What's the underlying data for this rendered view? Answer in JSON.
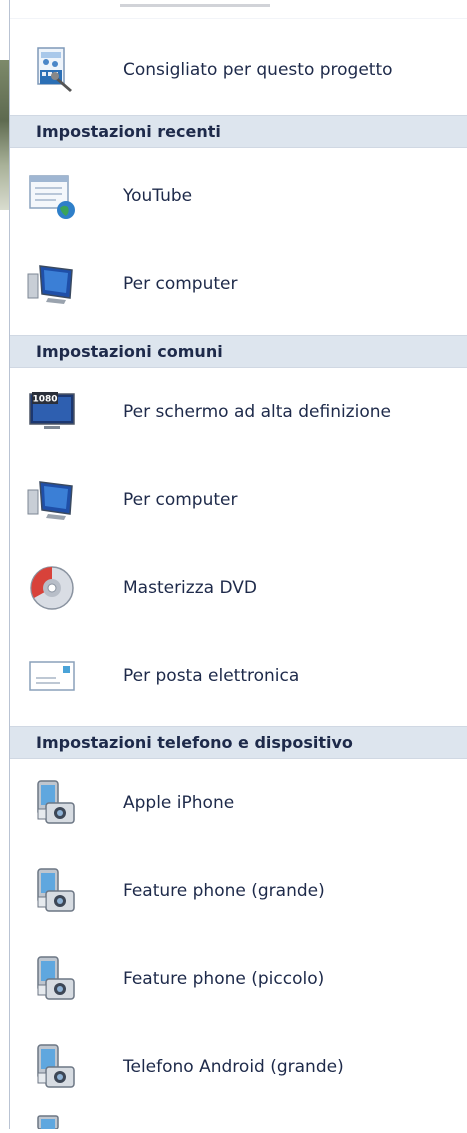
{
  "menu": {
    "top_item": {
      "label": "Consigliato per questo progetto",
      "icon": "project-recommended-icon"
    },
    "sections": [
      {
        "header": "Impostazioni recenti",
        "items": [
          {
            "label": "YouTube",
            "icon": "youtube-web-icon"
          },
          {
            "label": "Per computer",
            "icon": "computer-monitor-icon"
          }
        ]
      },
      {
        "header": "Impostazioni comuni",
        "items": [
          {
            "label": "Per schermo ad alta definizione",
            "icon": "hd-1080-monitor-icon",
            "badge": "1080"
          },
          {
            "label": "Per computer",
            "icon": "computer-monitor-icon"
          },
          {
            "label": "Masterizza DVD",
            "icon": "dvd-disc-icon"
          },
          {
            "label": "Per posta elettronica",
            "icon": "email-envelope-icon"
          }
        ]
      },
      {
        "header": "Impostazioni telefono e dispositivo",
        "items": [
          {
            "label": "Apple iPhone",
            "icon": "phone-device-icon"
          },
          {
            "label": "Feature phone (grande)",
            "icon": "phone-device-icon"
          },
          {
            "label": "Feature phone (piccolo)",
            "icon": "phone-device-icon"
          },
          {
            "label": "Telefono Android (grande)",
            "icon": "phone-device-icon"
          }
        ]
      }
    ]
  },
  "colors": {
    "header_bg": "#dde5ee",
    "text": "#1e2a4a"
  }
}
